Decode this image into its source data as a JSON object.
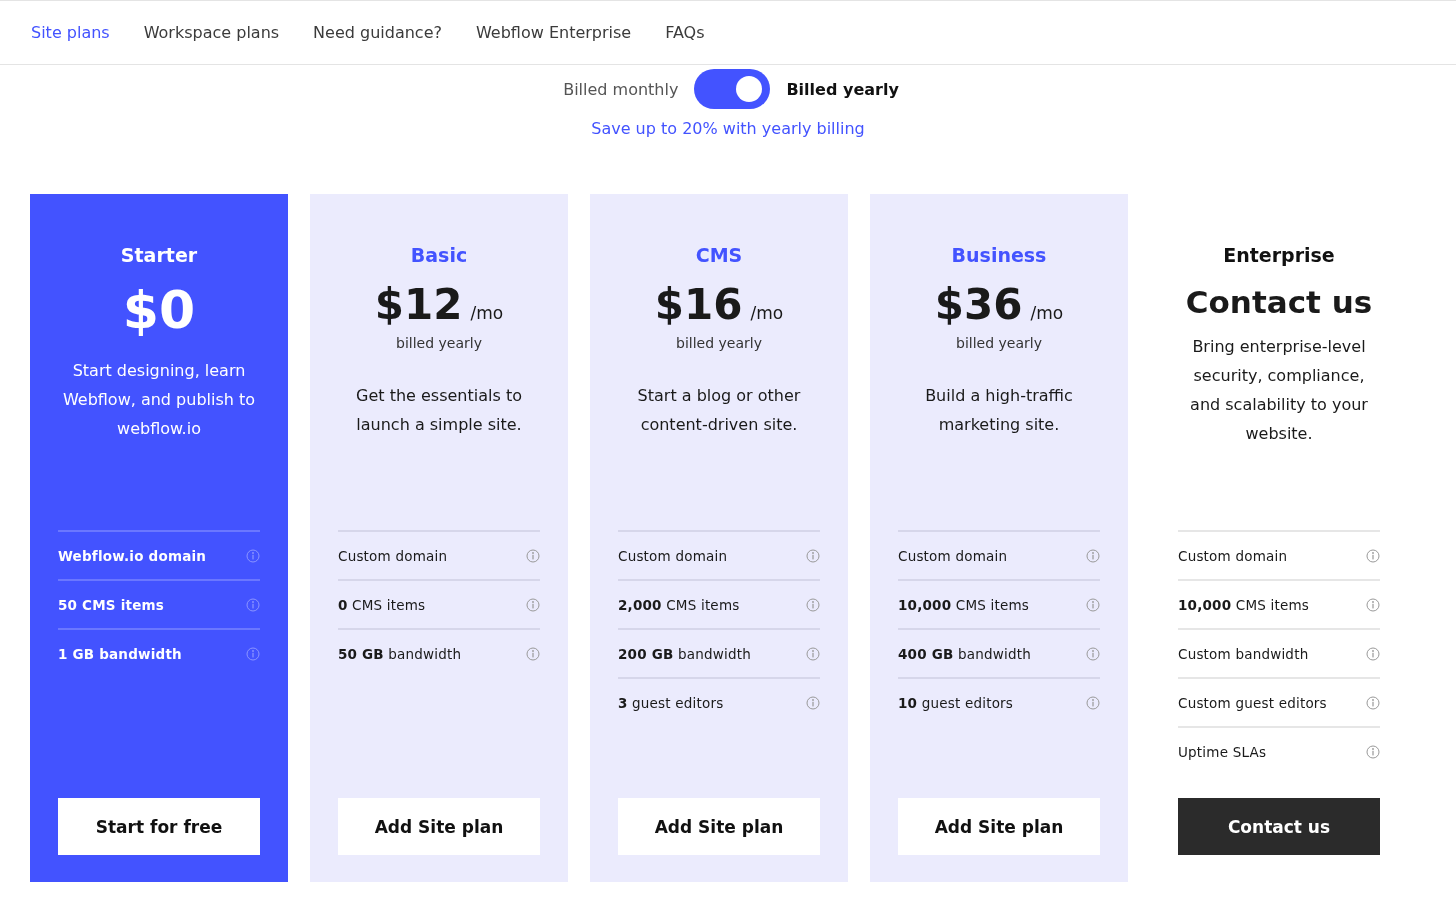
{
  "tabs": [
    {
      "label": "Site plans",
      "selected": true
    },
    {
      "label": "Workspace plans",
      "selected": false
    },
    {
      "label": "Need guidance?",
      "selected": false
    },
    {
      "label": "Webflow Enterprise",
      "selected": false
    },
    {
      "label": "FAQs",
      "selected": false
    }
  ],
  "billing": {
    "monthly_label": "Billed monthly",
    "yearly_label": "Billed yearly",
    "yearly": true,
    "savings_link": "Save up to 20% with yearly billing"
  },
  "plans": [
    {
      "kind": "featured",
      "name": "Starter",
      "price": "$0",
      "description": "Start designing, learn Webflow, and publish to webflow.io",
      "features": [
        "Webflow.io domain",
        "**50** CMS items",
        "**1 GB** bandwidth"
      ],
      "button": "Start for free"
    },
    {
      "kind": "standard",
      "name": "Basic",
      "price": "$12",
      "period": "/mo",
      "note": "billed yearly",
      "description": "Get the essentials to launch a simple site.",
      "features": [
        "Custom domain",
        "**0** CMS items",
        "**50 GB** bandwidth"
      ],
      "button": "Add Site plan"
    },
    {
      "kind": "standard",
      "name": "CMS",
      "price": "$16",
      "period": "/mo",
      "note": "billed yearly",
      "description": "Start a blog or other content-driven site.",
      "features": [
        "Custom domain",
        "**2,000** CMS items",
        "**200 GB** bandwidth",
        "**3** guest editors"
      ],
      "button": "Add Site plan"
    },
    {
      "kind": "standard",
      "name": "Business",
      "price": "$36",
      "period": "/mo",
      "note": "billed yearly",
      "description": "Build a high-traffic marketing site.",
      "features": [
        "Custom domain",
        "**10,000** CMS items",
        "**400 GB** bandwidth",
        "**10** guest editors"
      ],
      "button": "Add Site plan"
    },
    {
      "kind": "enterprise",
      "name": "Enterprise",
      "price": "Contact us",
      "description": "Bring enterprise-level security, compliance, and scalability to your website.",
      "features": [
        "Custom domain",
        "**10,000** CMS items",
        "Custom bandwidth",
        "Custom guest editors",
        "Uptime SLAs"
      ],
      "button": "Contact us"
    }
  ]
}
